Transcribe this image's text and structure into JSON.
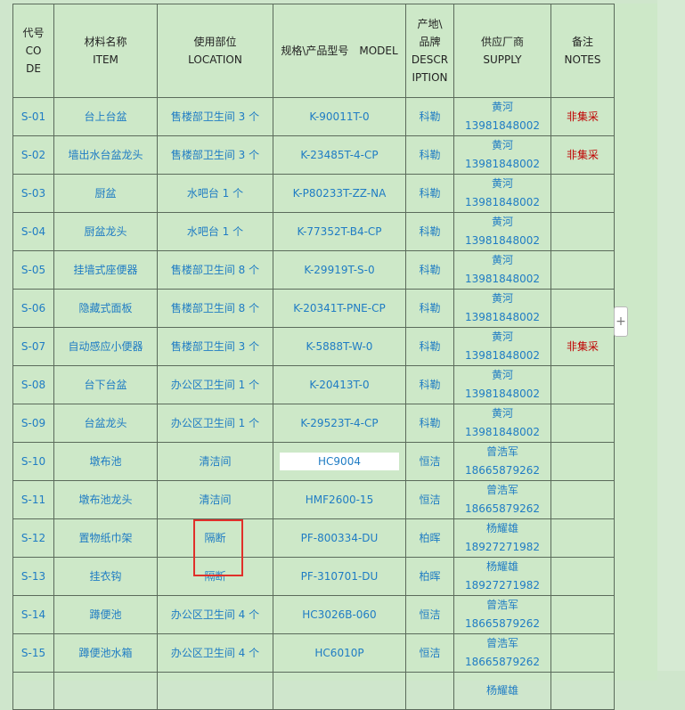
{
  "headers": {
    "code": [
      "代号",
      "CODE"
    ],
    "item": [
      "材料名称",
      "ITEM"
    ],
    "location": [
      "使用部位",
      "LOCATION"
    ],
    "model": "规格\\产品型号　MODEL",
    "description": [
      "产地\\",
      "品牌",
      "DESCRIPTION"
    ],
    "supply": [
      "供应厂商",
      "SUPPLY"
    ],
    "notes": [
      "备注",
      "NOTES"
    ]
  },
  "rows": [
    {
      "code": "S-01",
      "item": "台上台盆",
      "location": "售楼部卫生间 3 个",
      "model": "K-90011T-0",
      "brand": "科勒",
      "supplier_name": "黄河",
      "supplier_phone": "13981848002",
      "note": "非集采"
    },
    {
      "code": "S-02",
      "item": "墙出水台盆龙头",
      "location": "售楼部卫生间 3 个",
      "model": "K-23485T-4-CP",
      "brand": "科勒",
      "supplier_name": "黄河",
      "supplier_phone": "13981848002",
      "note": "非集采"
    },
    {
      "code": "S-03",
      "item": "厨盆",
      "location": "水吧台 1 个",
      "model": "K-P80233T-ZZ-NA",
      "brand": "科勒",
      "supplier_name": "黄河",
      "supplier_phone": "13981848002",
      "note": ""
    },
    {
      "code": "S-04",
      "item": "厨盆龙头",
      "location": "水吧台 1 个",
      "model": "K-77352T-B4-CP",
      "brand": "科勒",
      "supplier_name": "黄河",
      "supplier_phone": "13981848002",
      "note": ""
    },
    {
      "code": "S-05",
      "item": "挂墙式座便器",
      "location": "售楼部卫生间 8 个",
      "model": "K-29919T-S-0",
      "brand": "科勒",
      "supplier_name": "黄河",
      "supplier_phone": "13981848002",
      "note": ""
    },
    {
      "code": "S-06",
      "item": "隐藏式面板",
      "location": "售楼部卫生间 8 个",
      "model": "K-20341T-PNE-CP",
      "brand": "科勒",
      "supplier_name": "黄河",
      "supplier_phone": "13981848002",
      "note": ""
    },
    {
      "code": "S-07",
      "item": "自动感应小便器",
      "location": "售楼部卫生间 3 个",
      "model": "K-5888T-W-0",
      "brand": "科勒",
      "supplier_name": "黄河",
      "supplier_phone": "13981848002",
      "note": "非集采"
    },
    {
      "code": "S-08",
      "item": "台下台盆",
      "location": "办公区卫生间 1 个",
      "model": "K-20413T-0",
      "brand": "科勒",
      "supplier_name": "黄河",
      "supplier_phone": "13981848002",
      "note": ""
    },
    {
      "code": "S-09",
      "item": "台盆龙头",
      "location": "办公区卫生间 1 个",
      "model": "K-29523T-4-CP",
      "brand": "科勒",
      "supplier_name": "黄河",
      "supplier_phone": "13981848002",
      "note": ""
    },
    {
      "code": "S-10",
      "item": "墩布池",
      "location": "清洁间",
      "model": "HC9004",
      "brand": "恒洁",
      "supplier_name": "曾浩军",
      "supplier_phone": "18665879262",
      "note": ""
    },
    {
      "code": "S-11",
      "item": "墩布池龙头",
      "location": "清洁间",
      "model": "HMF2600-15",
      "brand": "恒洁",
      "supplier_name": "曾浩军",
      "supplier_phone": "18665879262",
      "note": ""
    },
    {
      "code": "S-12",
      "item": "置物纸巾架",
      "location": "隔断",
      "model": "PF-800334-DU",
      "brand": "柏晖",
      "supplier_name": "杨耀雄",
      "supplier_phone": "18927271982",
      "note": ""
    },
    {
      "code": "S-13",
      "item": "挂衣钩",
      "location": "隔断",
      "model": "PF-310701-DU",
      "brand": "柏晖",
      "supplier_name": "杨耀雄",
      "supplier_phone": "18927271982",
      "note": ""
    },
    {
      "code": "S-14",
      "item": "蹲便池",
      "location": "办公区卫生间 4 个",
      "model": "HC3026B-060",
      "brand": "恒洁",
      "supplier_name": "曾浩军",
      "supplier_phone": "18665879262",
      "note": ""
    },
    {
      "code": "S-15",
      "item": "蹲便池水箱",
      "location": "办公区卫生间 4 个",
      "model": "HC6010P",
      "brand": "恒洁",
      "supplier_name": "曾浩军",
      "supplier_phone": "18665879262",
      "note": ""
    },
    {
      "code": "",
      "item": "",
      "location": "",
      "model": "",
      "brand": "",
      "supplier_name": "杨耀雄",
      "supplier_phone": "",
      "note": ""
    }
  ],
  "add_button_label": "+",
  "colors": {
    "cell_text": "#1f7cc4",
    "note_text": "#c00000",
    "highlight_border": "#e0302a",
    "background": "#cde8c8"
  }
}
